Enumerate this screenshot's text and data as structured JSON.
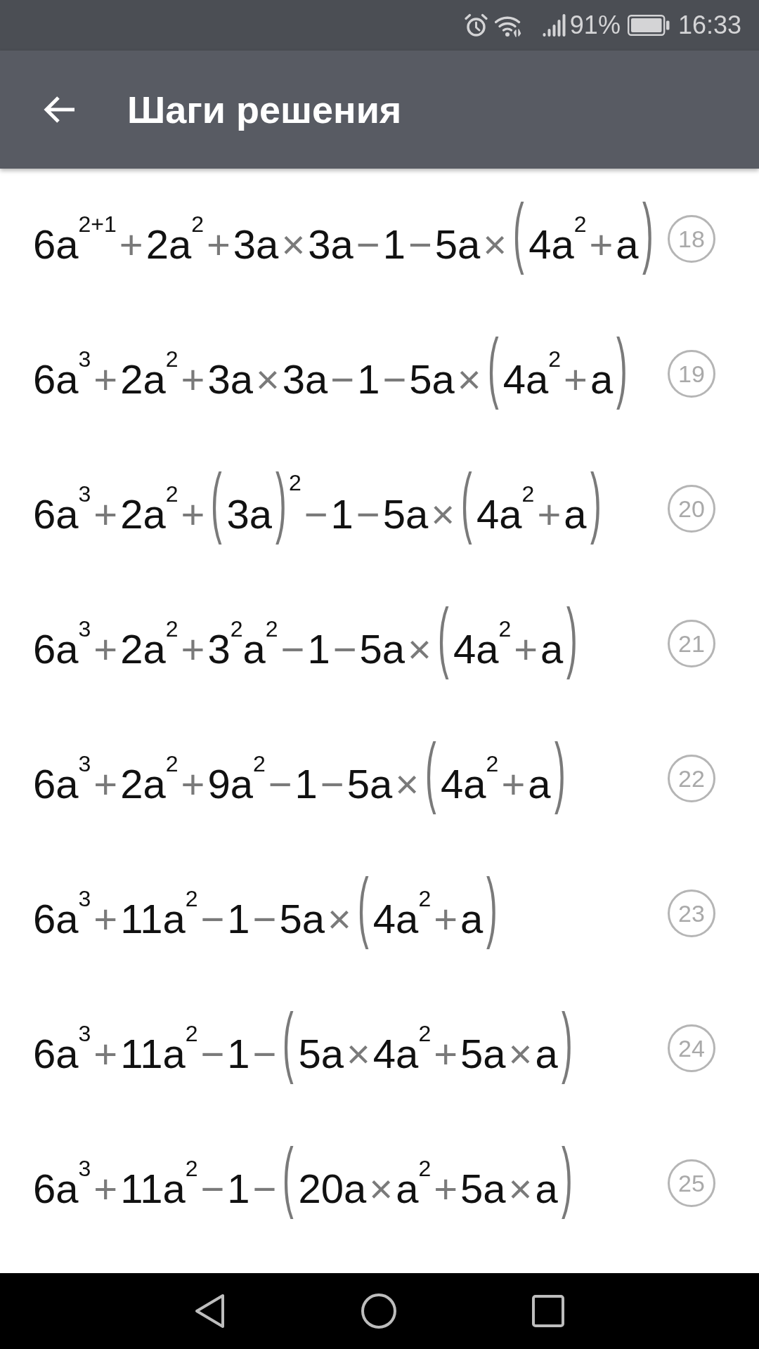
{
  "status_bar": {
    "battery_percent": "91%",
    "time": "16:33"
  },
  "app_bar": {
    "title": "Шаги решения"
  },
  "steps": [
    {
      "number": "18",
      "expression": "6a$^{2+1}$+2a$^{2}$+3a×3a−1−5a×(4a$^{2}$+a)"
    },
    {
      "number": "19",
      "expression": "6a$^{3}$+2a$^{2}$+3a×3a−1−5a×(4a$^{2}$+a)"
    },
    {
      "number": "20",
      "expression": "6a$^{3}$+2a$^{2}$+(3a)$^{2}$−1−5a×(4a$^{2}$+a)"
    },
    {
      "number": "21",
      "expression": "6a$^{3}$+2a$^{2}$+3$^{2}$a$^{2}$−1−5a×(4a$^{2}$+a)"
    },
    {
      "number": "22",
      "expression": "6a$^{3}$+2a$^{2}$+9a$^{2}$−1−5a×(4a$^{2}$+a)"
    },
    {
      "number": "23",
      "expression": "6a$^{3}$+11a$^{2}$−1−5a×(4a$^{2}$+a)"
    },
    {
      "number": "24",
      "expression": "6a$^{3}$+11a$^{2}$−1−(5a×4a$^{2}$+5a×a)"
    },
    {
      "number": "25",
      "expression": "6a$^{3}$+11a$^{2}$−1−(20a×a$^{2}$+5a×a)"
    }
  ]
}
